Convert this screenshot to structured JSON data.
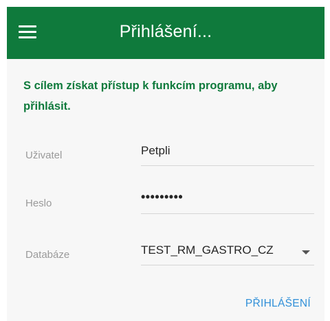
{
  "header": {
    "title": "Přihlášení...",
    "menu_icon": "hamburger-menu-icon",
    "bg_color": "#0f7a3c"
  },
  "intro_text": "S cílem získat přístup k funkcím programu, aby přihlásit.",
  "form": {
    "user": {
      "label": "Uživatel",
      "value": "Petpli"
    },
    "password": {
      "label": "Heslo",
      "value": "•••••••••"
    },
    "database": {
      "label": "Databáze",
      "value": "TEST_RM_GASTRO_CZ",
      "icon": "dropdown-arrow-icon"
    }
  },
  "actions": {
    "login_label": "PŘIHLÁŠENÍ",
    "accent_color": "#2f8fd8"
  }
}
